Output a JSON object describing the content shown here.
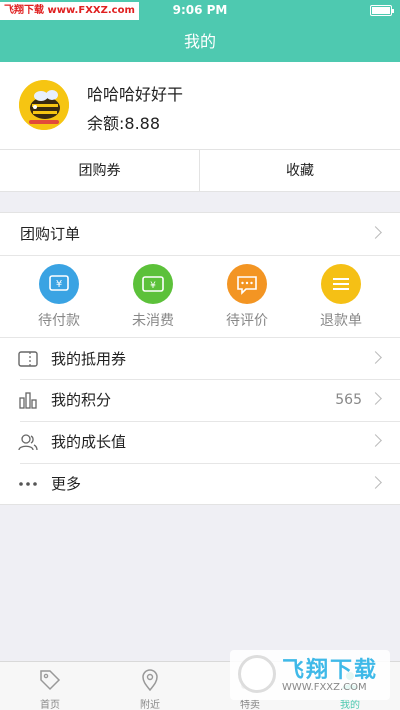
{
  "status": {
    "time": "9:06 PM",
    "watermark_a": "飞翔下载",
    "watermark_b": "www.FXXZ.com"
  },
  "header": {
    "title": "我的"
  },
  "profile": {
    "username": "哈哈哈好好干",
    "balance": "余额:8.88"
  },
  "quick_tabs": [
    {
      "label": "团购券"
    },
    {
      "label": "收藏"
    }
  ],
  "orders": {
    "title": "团购订单",
    "items": [
      {
        "label": "待付款",
        "icon": "yen-icon",
        "color": "#3aa3e3"
      },
      {
        "label": "未消费",
        "icon": "ticket-icon",
        "color": "#5cc13a"
      },
      {
        "label": "待评价",
        "icon": "comment-icon",
        "color": "#f39523"
      },
      {
        "label": "退款单",
        "icon": "list-icon",
        "color": "#f5c015"
      }
    ]
  },
  "menu": [
    {
      "label": "我的抵用券",
      "icon": "voucher-icon",
      "value": ""
    },
    {
      "label": "我的积分",
      "icon": "points-icon",
      "value": "565"
    },
    {
      "label": "我的成长值",
      "icon": "users-icon",
      "value": ""
    },
    {
      "label": "更多",
      "icon": "more-icon",
      "value": ""
    }
  ],
  "tabbar": [
    {
      "label": "首页",
      "icon": "tag-icon"
    },
    {
      "label": "附近",
      "icon": "location-icon"
    },
    {
      "label": "特卖",
      "icon": "sale-icon"
    },
    {
      "label": "我的",
      "icon": "me-icon"
    }
  ],
  "watermark": {
    "big": "飞翔下载",
    "small": "WWW.FXXZ.COM"
  },
  "colors": {
    "accent": "#4ec9b0"
  }
}
